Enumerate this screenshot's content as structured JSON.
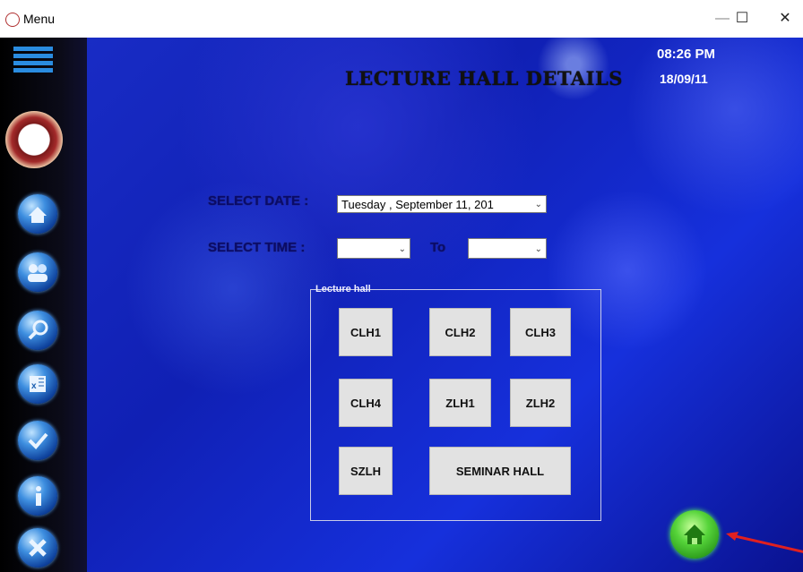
{
  "window": {
    "title": "Menu",
    "minimize": "—",
    "maximize": "☐",
    "close": "✕"
  },
  "header": {
    "title": "LECTURE HALL DETAILS",
    "time": "08:26 PM",
    "date": "18/09/11"
  },
  "form": {
    "date_label": "SELECT DATE :",
    "date_value": "Tuesday   , September 11, 201",
    "time_label": "SELECT TIME  :",
    "time_from": "",
    "to_label": "To",
    "time_to": ""
  },
  "lecture_hall": {
    "legend": "Lecture hall",
    "buttons": [
      "CLH1",
      "CLH2",
      "CLH3",
      "CLH4",
      "ZLH1",
      "ZLH2",
      "SZLH",
      "SEMINAR HALL"
    ]
  },
  "sidebar": {
    "icons": [
      "menu-icon",
      "emblem-logo",
      "home-icon",
      "users-icon",
      "search-icon",
      "excel-icon",
      "check-icon",
      "info-icon",
      "exit-icon"
    ]
  },
  "colors": {
    "accent": "#1a2ec8",
    "home_button": "#3cc02a",
    "arrow": "#e02020"
  }
}
